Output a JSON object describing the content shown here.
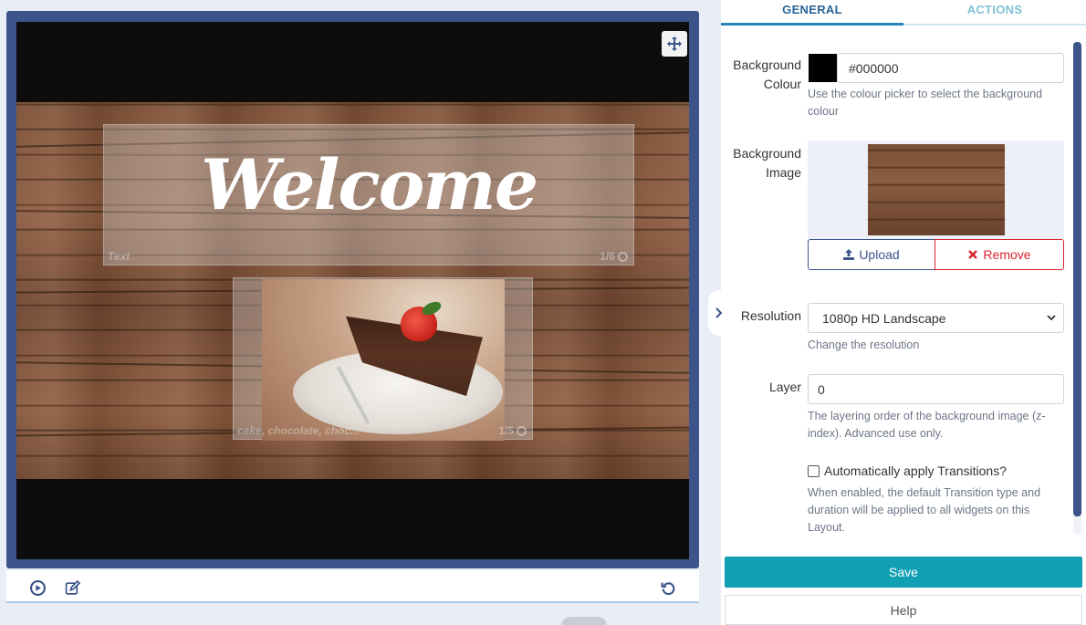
{
  "editor": {
    "text_widget": {
      "content": "Welcome",
      "label": "Text",
      "count": "1/6"
    },
    "image_widget": {
      "label": "cake, chocolate, choc...",
      "count": "1/5"
    }
  },
  "toolbar": {
    "play_icon": "play-circle-icon",
    "edit_icon": "edit-icon",
    "undo_icon": "undo-icon"
  },
  "tabs": [
    {
      "label": "GENERAL",
      "active": true
    },
    {
      "label": "ACTIONS",
      "active": false
    }
  ],
  "form": {
    "background_colour": {
      "label_line1": "Background",
      "label_line2": "Colour",
      "value": "#000000",
      "swatch": "#000000",
      "help": "Use the colour picker to select the background colour"
    },
    "background_image": {
      "label_line1": "Background",
      "label_line2": "Image",
      "upload_label": "Upload",
      "remove_label": "Remove"
    },
    "resolution": {
      "label": "Resolution",
      "selected": "1080p HD Landscape",
      "help": "Change the resolution"
    },
    "layer": {
      "label": "Layer",
      "value": "0",
      "help": "The layering order of the background image (z-index). Advanced use only."
    },
    "auto_transitions": {
      "label": "Automatically apply Transitions?",
      "checked": false,
      "help": "When enabled, the default Transition type and duration will be applied to all widgets on this Layout."
    }
  },
  "actions": {
    "save_label": "Save",
    "help_label": "Help"
  },
  "colors": {
    "frame": "#3c5489",
    "accent_teal": "#119fb3",
    "remove_red": "#d9232d"
  }
}
